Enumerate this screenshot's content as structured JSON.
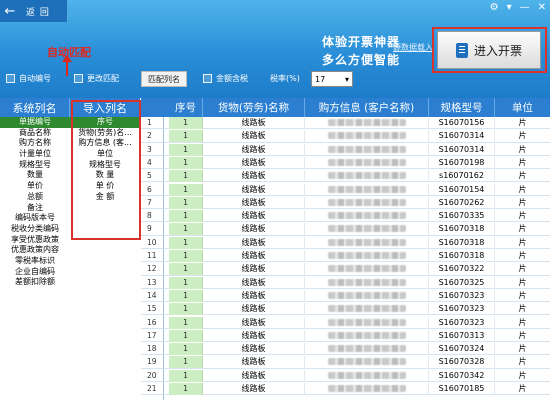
{
  "header": {
    "back_label": "返 回",
    "ad_line1": "体验开票神器",
    "ad_line2": "多么方便智能",
    "import_link": "源数据载入",
    "cta_label": "进入开票",
    "window_controls": [
      "⚙",
      "▾",
      "—",
      "✕"
    ]
  },
  "annotation": {
    "auto_match_label": "自动匹配"
  },
  "toolbar": {
    "auto_number_label": "自动编号",
    "change_match_label": "更改匹配",
    "match_columns_button": "匹配列名",
    "amount_tax_label": "金额含税",
    "tax_rate_label": "税率(%)",
    "tax_rate_value": "17"
  },
  "mapping": {
    "system_header": "系统列名",
    "import_header": "导入列名",
    "system_columns": [
      "单据编号",
      "商品名称",
      "购方名称",
      "计量单位",
      "规格型号",
      "数量",
      "单价",
      "总额",
      "备注",
      "编码版本号",
      "税收分类编码",
      "享受优惠政策",
      "优惠政策内容",
      "零税率标识",
      "企业自编码",
      "差额扣除额"
    ],
    "import_columns": [
      "序号",
      "货物(劳务)名...",
      "购方信息 (客...",
      "单位",
      "规格型号",
      "数 量",
      "单 价",
      "金 额"
    ]
  },
  "grid": {
    "headers": [
      "序号",
      "货物(劳务)名称",
      "购方信息 (客户名称)",
      "规格型号",
      "单位"
    ],
    "rows": [
      {
        "idx": "1",
        "no": "1",
        "goods": "线路板",
        "spec": "S16070156",
        "unit": "片"
      },
      {
        "idx": "2",
        "no": "1",
        "goods": "线路板",
        "spec": "S16070314",
        "unit": "片"
      },
      {
        "idx": "3",
        "no": "1",
        "goods": "线路板",
        "spec": "S16070314",
        "unit": "片"
      },
      {
        "idx": "4",
        "no": "1",
        "goods": "线路板",
        "spec": "S16070198",
        "unit": "片"
      },
      {
        "idx": "5",
        "no": "1",
        "goods": "线路板",
        "spec": "s16070162",
        "unit": "片"
      },
      {
        "idx": "6",
        "no": "1",
        "goods": "线路板",
        "spec": "S16070154",
        "unit": "片"
      },
      {
        "idx": "7",
        "no": "1",
        "goods": "线路板",
        "spec": "S16070262",
        "unit": "片"
      },
      {
        "idx": "8",
        "no": "1",
        "goods": "线路板",
        "spec": "S16070335",
        "unit": "片"
      },
      {
        "idx": "9",
        "no": "1",
        "goods": "线路板",
        "spec": "S16070318",
        "unit": "片"
      },
      {
        "idx": "10",
        "no": "1",
        "goods": "线路板",
        "spec": "S16070318",
        "unit": "片"
      },
      {
        "idx": "11",
        "no": "1",
        "goods": "线路板",
        "spec": "S16070318",
        "unit": "片"
      },
      {
        "idx": "12",
        "no": "1",
        "goods": "线路板",
        "spec": "S16070322",
        "unit": "片"
      },
      {
        "idx": "13",
        "no": "1",
        "goods": "线路板",
        "spec": "S16070325",
        "unit": "片"
      },
      {
        "idx": "14",
        "no": "1",
        "goods": "线路板",
        "spec": "S16070323",
        "unit": "片"
      },
      {
        "idx": "15",
        "no": "1",
        "goods": "线路板",
        "spec": "S16070323",
        "unit": "片"
      },
      {
        "idx": "16",
        "no": "1",
        "goods": "线路板",
        "spec": "S16070323",
        "unit": "片"
      },
      {
        "idx": "17",
        "no": "1",
        "goods": "线路板",
        "spec": "S16070313",
        "unit": "片"
      },
      {
        "idx": "18",
        "no": "1",
        "goods": "线路板",
        "spec": "S16070324",
        "unit": "片"
      },
      {
        "idx": "19",
        "no": "1",
        "goods": "线路板",
        "spec": "S16070328",
        "unit": "片"
      },
      {
        "idx": "20",
        "no": "1",
        "goods": "线路板",
        "spec": "S16070342",
        "unit": "片"
      },
      {
        "idx": "21",
        "no": "1",
        "goods": "线路板",
        "spec": "S16070185",
        "unit": "片"
      }
    ]
  },
  "colors": {
    "header_blue": "#2c7fd0",
    "selected_green": "#2f8a2f",
    "highlight_red": "#d9332b"
  }
}
